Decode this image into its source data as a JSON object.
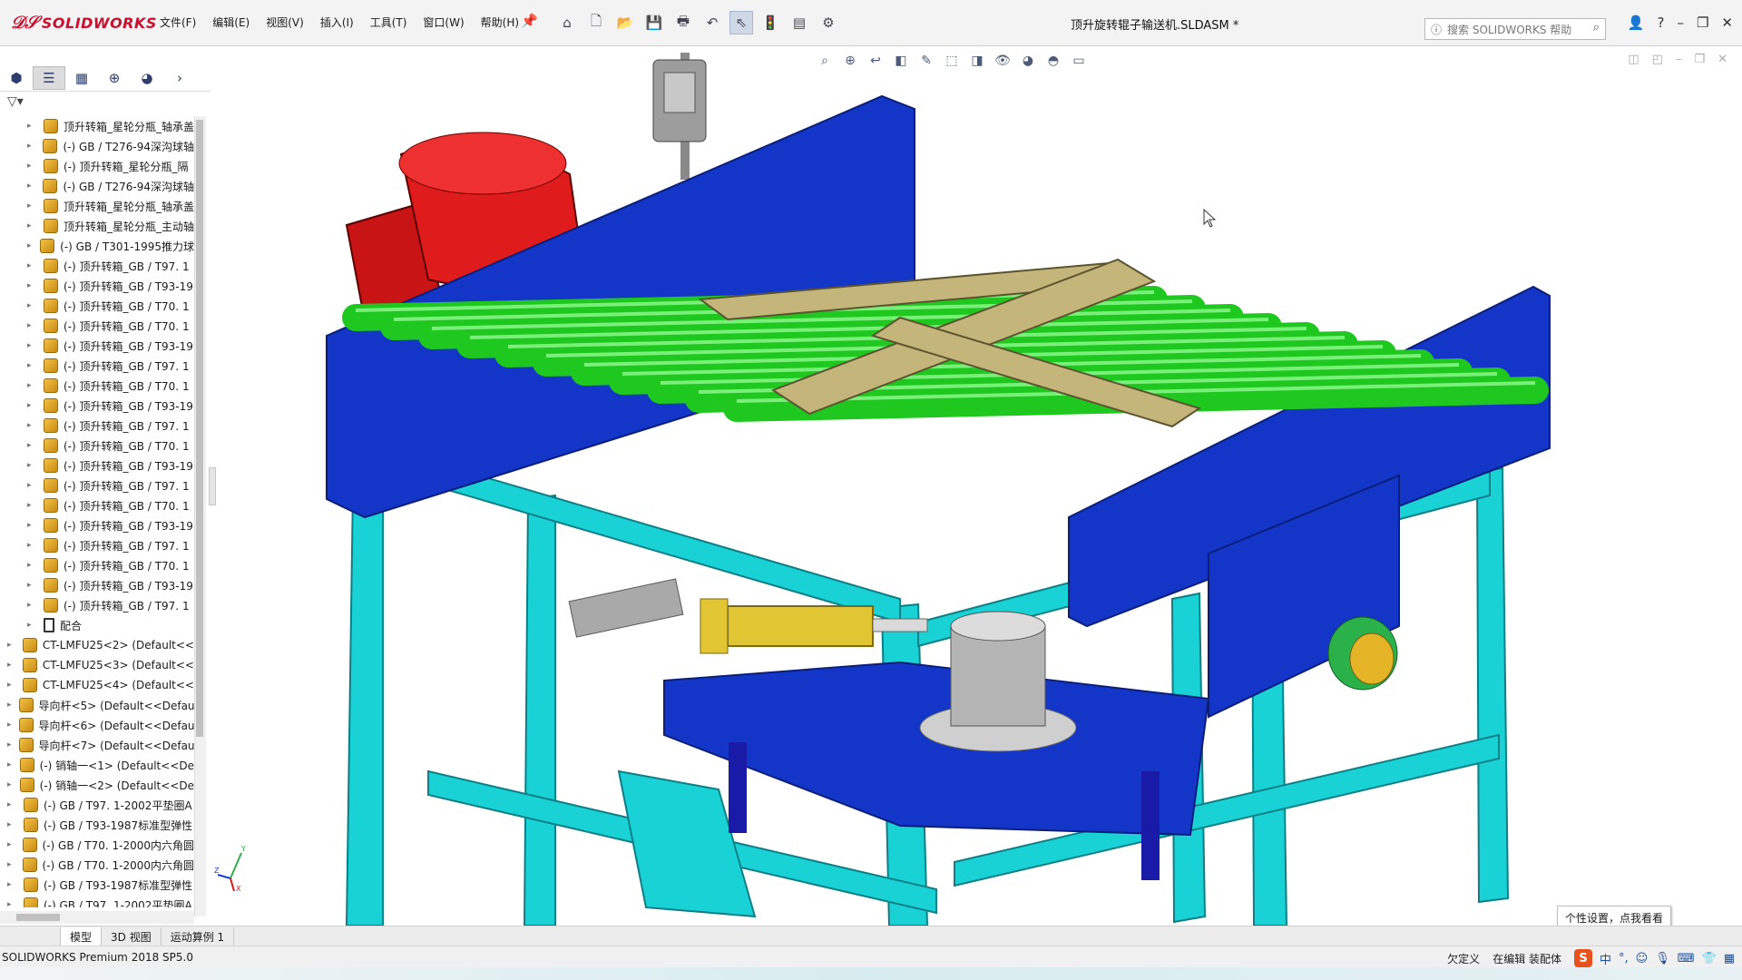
{
  "app": {
    "logo_text": "SOLIDWORKS",
    "document_title": "顶升旋转辊子输送机.SLDASM *"
  },
  "menu": [
    "文件(F)",
    "编辑(E)",
    "视图(V)",
    "插入(I)",
    "工具(T)",
    "窗口(W)",
    "帮助(H)"
  ],
  "search": {
    "placeholder": "搜索 SOLIDWORKS 帮助"
  },
  "tree": {
    "items": [
      {
        "label": "顶升转箱_星轮分瓶_轴承盖",
        "indent": 1,
        "icon": "part-icon"
      },
      {
        "label": "(-) GB / T276-94深沟球轴",
        "indent": 1,
        "icon": "part-icon"
      },
      {
        "label": "(-) 顶升转箱_星轮分瓶_隔",
        "indent": 1,
        "icon": "part-icon"
      },
      {
        "label": "(-) GB / T276-94深沟球轴",
        "indent": 1,
        "icon": "part-icon"
      },
      {
        "label": "顶升转箱_星轮分瓶_轴承盖",
        "indent": 1,
        "icon": "part-icon"
      },
      {
        "label": "顶升转箱_星轮分瓶_主动轴",
        "indent": 1,
        "icon": "part-icon"
      },
      {
        "label": "(-) GB / T301-1995推力球",
        "indent": 1,
        "icon": "part-icon"
      },
      {
        "label": "(-) 顶升转箱_GB / T97. 1",
        "indent": 1,
        "icon": "part-icon"
      },
      {
        "label": "(-) 顶升转箱_GB / T93-19",
        "indent": 1,
        "icon": "part-icon"
      },
      {
        "label": "(-) 顶升转箱_GB / T70. 1",
        "indent": 1,
        "icon": "part-icon"
      },
      {
        "label": "(-) 顶升转箱_GB / T70. 1",
        "indent": 1,
        "icon": "part-icon"
      },
      {
        "label": "(-) 顶升转箱_GB / T93-19",
        "indent": 1,
        "icon": "part-icon"
      },
      {
        "label": "(-) 顶升转箱_GB / T97. 1",
        "indent": 1,
        "icon": "part-icon"
      },
      {
        "label": "(-) 顶升转箱_GB / T70. 1",
        "indent": 1,
        "icon": "part-icon"
      },
      {
        "label": "(-) 顶升转箱_GB / T93-19",
        "indent": 1,
        "icon": "part-icon"
      },
      {
        "label": "(-) 顶升转箱_GB / T97. 1",
        "indent": 1,
        "icon": "part-icon"
      },
      {
        "label": "(-) 顶升转箱_GB / T70. 1",
        "indent": 1,
        "icon": "part-icon"
      },
      {
        "label": "(-) 顶升转箱_GB / T93-19",
        "indent": 1,
        "icon": "part-icon"
      },
      {
        "label": "(-) 顶升转箱_GB / T97. 1",
        "indent": 1,
        "icon": "part-icon"
      },
      {
        "label": "(-) 顶升转箱_GB / T70. 1",
        "indent": 1,
        "icon": "part-icon"
      },
      {
        "label": "(-) 顶升转箱_GB / T93-19",
        "indent": 1,
        "icon": "part-icon"
      },
      {
        "label": "(-) 顶升转箱_GB / T97. 1",
        "indent": 1,
        "icon": "part-icon"
      },
      {
        "label": "(-) 顶升转箱_GB / T70. 1",
        "indent": 1,
        "icon": "part-icon"
      },
      {
        "label": "(-) 顶升转箱_GB / T93-19",
        "indent": 1,
        "icon": "part-icon"
      },
      {
        "label": "(-) 顶升转箱_GB / T97. 1",
        "indent": 1,
        "icon": "part-icon"
      },
      {
        "label": "配合",
        "indent": 1,
        "icon": "mate-icon"
      },
      {
        "label": "CT-LMFU25<2> (Default<<",
        "indent": 0,
        "icon": "part-icon"
      },
      {
        "label": "CT-LMFU25<3> (Default<<",
        "indent": 0,
        "icon": "part-icon"
      },
      {
        "label": "CT-LMFU25<4> (Default<<",
        "indent": 0,
        "icon": "part-icon"
      },
      {
        "label": "导向杆<5> (Default<<Defau",
        "indent": 0,
        "icon": "part-icon"
      },
      {
        "label": "导向杆<6> (Default<<Defau",
        "indent": 0,
        "icon": "part-icon"
      },
      {
        "label": "导向杆<7> (Default<<Defau",
        "indent": 0,
        "icon": "part-icon"
      },
      {
        "label": "(-) 销轴一<1> (Default<<De",
        "indent": 0,
        "icon": "part-icon"
      },
      {
        "label": "(-) 销轴一<2> (Default<<De",
        "indent": 0,
        "icon": "part-icon"
      },
      {
        "label": "(-) GB / T97. 1-2002平垫圈A",
        "indent": 0,
        "icon": "part-icon"
      },
      {
        "label": "(-) GB / T93-1987标准型弹性",
        "indent": 0,
        "icon": "part-icon"
      },
      {
        "label": "(-) GB / T70. 1-2000内六角圆",
        "indent": 0,
        "icon": "part-icon"
      },
      {
        "label": "(-) GB / T70. 1-2000内六角圆",
        "indent": 0,
        "icon": "part-icon"
      },
      {
        "label": "(-) GB / T93-1987标准型弹性",
        "indent": 0,
        "icon": "part-icon"
      },
      {
        "label": "(-) GB / T97. 1-2002平垫圈A",
        "indent": 0,
        "icon": "part-icon"
      }
    ]
  },
  "bottom_tabs": [
    "模型",
    "3D 视图",
    "运动算例 1"
  ],
  "status": {
    "product": "SOLIDWORKS Premium 2018 SP5.0",
    "undefined": "欠定义",
    "editing": "在编辑 装配体"
  },
  "tooltip": "个性设置，点我看看",
  "ime": {
    "logo": "S",
    "lang": "中"
  },
  "colors": {
    "frame_blue": "#1335c8",
    "roller_green": "#1fc81f",
    "stand_cyan": "#19d2d6",
    "motor_red": "#d81818",
    "plate_tan": "#c4b67a",
    "brand_red": "#c8102e"
  }
}
